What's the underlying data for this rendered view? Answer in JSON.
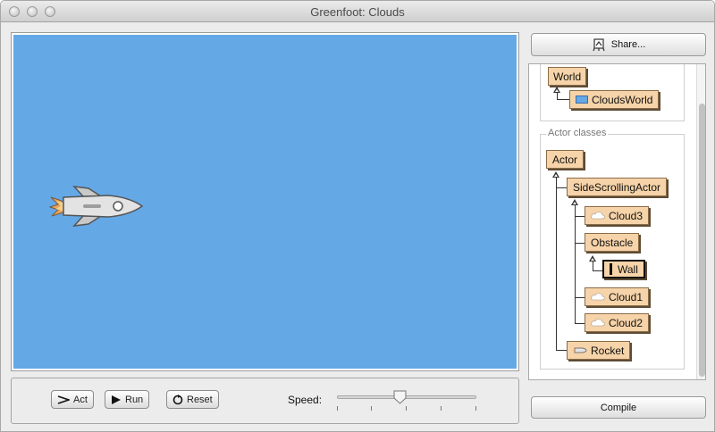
{
  "window": {
    "title": "Greenfoot: Clouds"
  },
  "world": {
    "background_color": "#64a8e6",
    "actor_icon": "rocket-icon"
  },
  "controls": {
    "act_label": "Act",
    "run_label": "Run",
    "reset_label": "Reset",
    "speed_label": "Speed:",
    "speed_fraction": 0.45
  },
  "share": {
    "label": "Share...",
    "icon": "share-icon"
  },
  "classes": {
    "world_classes": [
      {
        "name": "World"
      },
      {
        "name": "CloudsWorld",
        "icon": "world-thumbnail-icon"
      }
    ],
    "actor_group_label": "Actor classes",
    "actor_classes": [
      {
        "name": "Actor"
      },
      {
        "name": "SideScrollingActor"
      },
      {
        "name": "Cloud3",
        "icon": "cloud-icon"
      },
      {
        "name": "Obstacle"
      },
      {
        "name": "Wall",
        "icon": "wall-icon",
        "selected": true
      },
      {
        "name": "Cloud1",
        "icon": "cloud-icon"
      },
      {
        "name": "Cloud2",
        "icon": "cloud-icon"
      },
      {
        "name": "Rocket",
        "icon": "rocket-icon"
      }
    ]
  },
  "compile": {
    "label": "Compile"
  },
  "colors": {
    "class_fill": "#f6d3a8",
    "world_bg": "#64a8e6"
  }
}
